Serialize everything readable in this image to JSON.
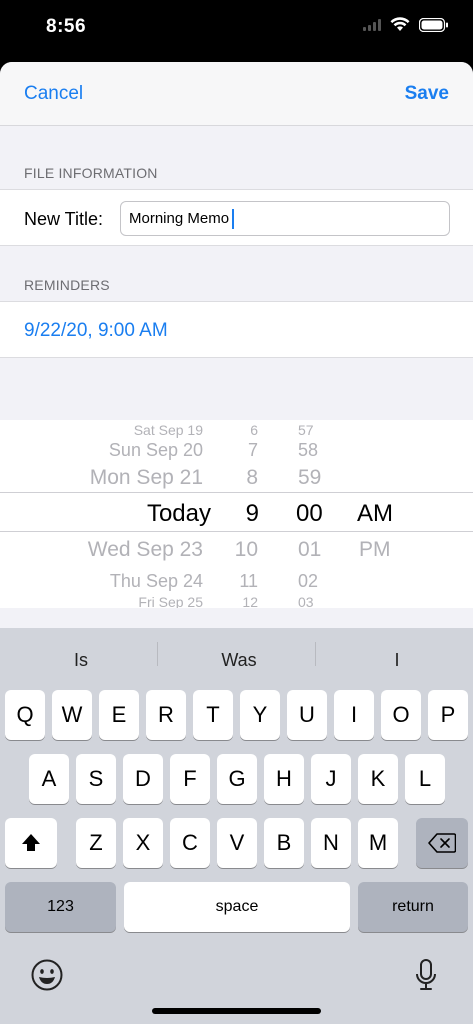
{
  "status": {
    "time": "8:56"
  },
  "nav": {
    "cancel": "Cancel",
    "save": "Save"
  },
  "file_info": {
    "header": "FILE INFORMATION",
    "title_label": "New Title:",
    "title_value": "Morning Memo"
  },
  "reminders": {
    "header": "REMINDERS",
    "value": "9/22/20, 9:00 AM"
  },
  "picker": {
    "dates": [
      "Sat Sep 19",
      "Sun Sep 20",
      "Mon Sep 21",
      "Today",
      "Wed Sep 23",
      "Thu Sep 24",
      "Fri Sep 25"
    ],
    "hours": [
      "6",
      "7",
      "8",
      "9",
      "10",
      "11",
      "12"
    ],
    "minutes": [
      "57",
      "58",
      "59",
      "00",
      "01",
      "02",
      "03"
    ],
    "ampm": [
      "AM",
      "PM"
    ]
  },
  "keyboard": {
    "suggestions": [
      "Is",
      "Was",
      "I"
    ],
    "row1": [
      "Q",
      "W",
      "E",
      "R",
      "T",
      "Y",
      "U",
      "I",
      "O",
      "P"
    ],
    "row2": [
      "A",
      "S",
      "D",
      "F",
      "G",
      "H",
      "J",
      "K",
      "L"
    ],
    "row3": [
      "Z",
      "X",
      "C",
      "V",
      "B",
      "N",
      "M"
    ],
    "numbers_key": "123",
    "space_key": "space",
    "return_key": "return"
  },
  "icons": {
    "shift": "shift-icon",
    "delete": "delete-icon",
    "emoji": "emoji-icon",
    "mic": "microphone-icon"
  }
}
